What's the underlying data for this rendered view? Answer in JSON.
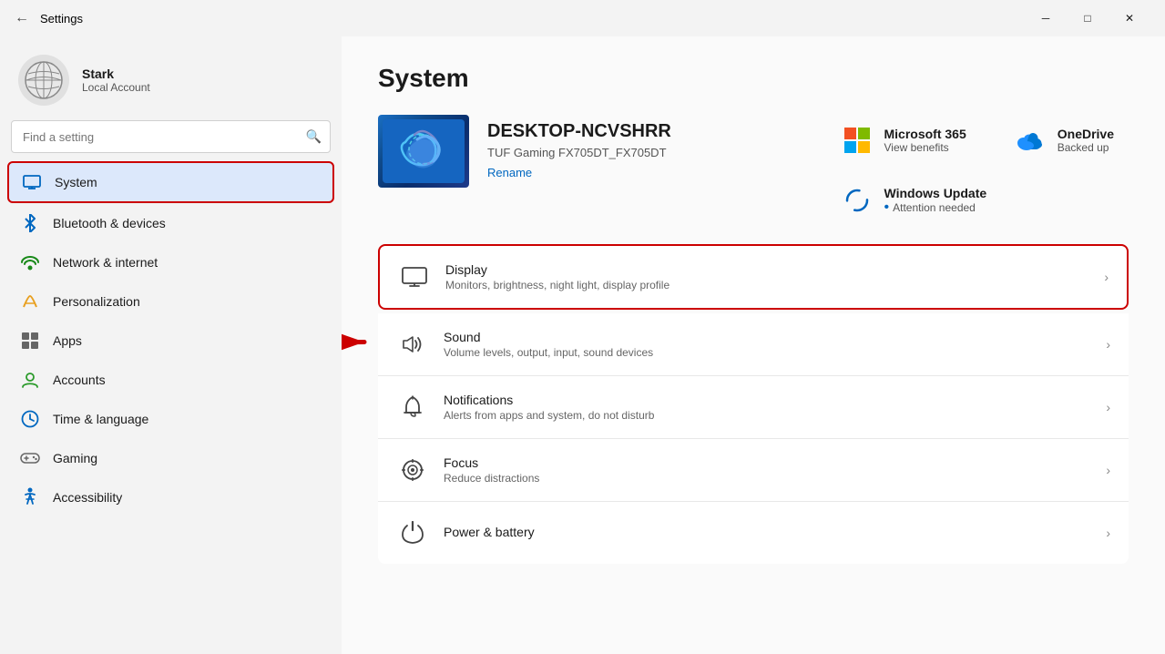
{
  "titleBar": {
    "title": "Settings",
    "minimizeLabel": "─",
    "maximizeLabel": "□",
    "closeLabel": "✕"
  },
  "sidebar": {
    "user": {
      "name": "Stark",
      "type": "Local Account"
    },
    "search": {
      "placeholder": "Find a setting"
    },
    "navItems": [
      {
        "id": "system",
        "label": "System",
        "active": true
      },
      {
        "id": "bluetooth",
        "label": "Bluetooth & devices"
      },
      {
        "id": "network",
        "label": "Network & internet"
      },
      {
        "id": "personalization",
        "label": "Personalization"
      },
      {
        "id": "apps",
        "label": "Apps"
      },
      {
        "id": "accounts",
        "label": "Accounts"
      },
      {
        "id": "time",
        "label": "Time & language"
      },
      {
        "id": "gaming",
        "label": "Gaming"
      },
      {
        "id": "accessibility",
        "label": "Accessibility"
      }
    ]
  },
  "content": {
    "pageTitle": "System",
    "device": {
      "name": "DESKTOP-NCVSHRR",
      "model": "TUF Gaming FX705DT_FX705DT",
      "renameLabel": "Rename"
    },
    "infoCards": [
      {
        "id": "ms365",
        "title": "Microsoft 365",
        "subtitle": "View benefits"
      },
      {
        "id": "onedrive",
        "title": "OneDrive",
        "subtitle": "Backed up"
      },
      {
        "id": "windowsupdate",
        "title": "Windows Update",
        "subtitle": "Attention needed"
      }
    ],
    "settingsItems": [
      {
        "id": "display",
        "title": "Display",
        "subtitle": "Monitors, brightness, night light, display profile",
        "highlighted": true
      },
      {
        "id": "sound",
        "title": "Sound",
        "subtitle": "Volume levels, output, input, sound devices"
      },
      {
        "id": "notifications",
        "title": "Notifications",
        "subtitle": "Alerts from apps and system, do not disturb"
      },
      {
        "id": "focus",
        "title": "Focus",
        "subtitle": "Reduce distractions"
      },
      {
        "id": "power",
        "title": "Power & battery",
        "subtitle": ""
      }
    ]
  }
}
